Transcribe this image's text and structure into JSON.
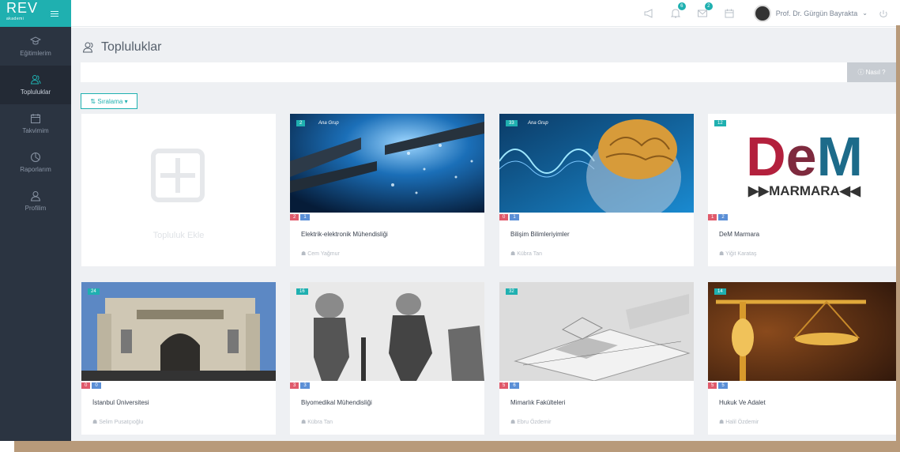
{
  "brand": {
    "logo": "REV",
    "sub": "akademi"
  },
  "sidebar": {
    "items": [
      {
        "label": "Eğitimlerim",
        "icon": "graduation-cap-icon"
      },
      {
        "label": "Topluluklar",
        "icon": "users-icon",
        "active": true
      },
      {
        "label": "Takvimim",
        "icon": "calendar-icon"
      },
      {
        "label": "Raporlarım",
        "icon": "pie-chart-icon"
      },
      {
        "label": "Profilim",
        "icon": "user-icon"
      }
    ]
  },
  "topbar": {
    "notifications_count": "6",
    "messages_count": "2",
    "user_name": "Prof. Dr. Gürgün Bayrakta"
  },
  "page": {
    "title": "Topluluklar",
    "help_label": "ⓘ Nasıl ?",
    "sort_label": "⇅ Sıralama ▾"
  },
  "add_card": {
    "label": "Topluluk Ekle"
  },
  "cards": [
    {
      "title": "Elektrik-elektronik Mühendisliği",
      "owner": "Cem Yağmur",
      "count": "2",
      "tag": "Ana Grup",
      "stat1": "2",
      "stat2": "1"
    },
    {
      "title": "Bilişim Bilimleriyimler",
      "owner": "Kübra Tan",
      "count": "33",
      "tag": "Ana Grup",
      "stat1": "0",
      "stat2": "1"
    },
    {
      "title": "DeM Marmara",
      "owner": "Yiğit Karataş",
      "count": "12",
      "tag": "",
      "stat1": "1",
      "stat2": "2"
    },
    {
      "title": "İstanbul Üniversitesi",
      "owner": "Selim Pusatçıoğlu",
      "count": "24",
      "tag": "",
      "stat1": "0",
      "stat2": "0"
    },
    {
      "title": "Biyomedikal Mühendisliği",
      "owner": "Kübra Tan",
      "count": "16",
      "tag": "",
      "stat1": "3",
      "stat2": "3"
    },
    {
      "title": "Mimarlık Fakülteleri",
      "owner": "Ebru Özdemir",
      "count": "32",
      "tag": "",
      "stat1": "5",
      "stat2": "6"
    },
    {
      "title": "Hukuk Ve Adalet",
      "owner": "Halil Özdemir",
      "count": "14",
      "tag": "",
      "stat1": "5",
      "stat2": "5"
    }
  ],
  "dem_logo": {
    "word": "DeM",
    "sub": "MARMARA"
  }
}
